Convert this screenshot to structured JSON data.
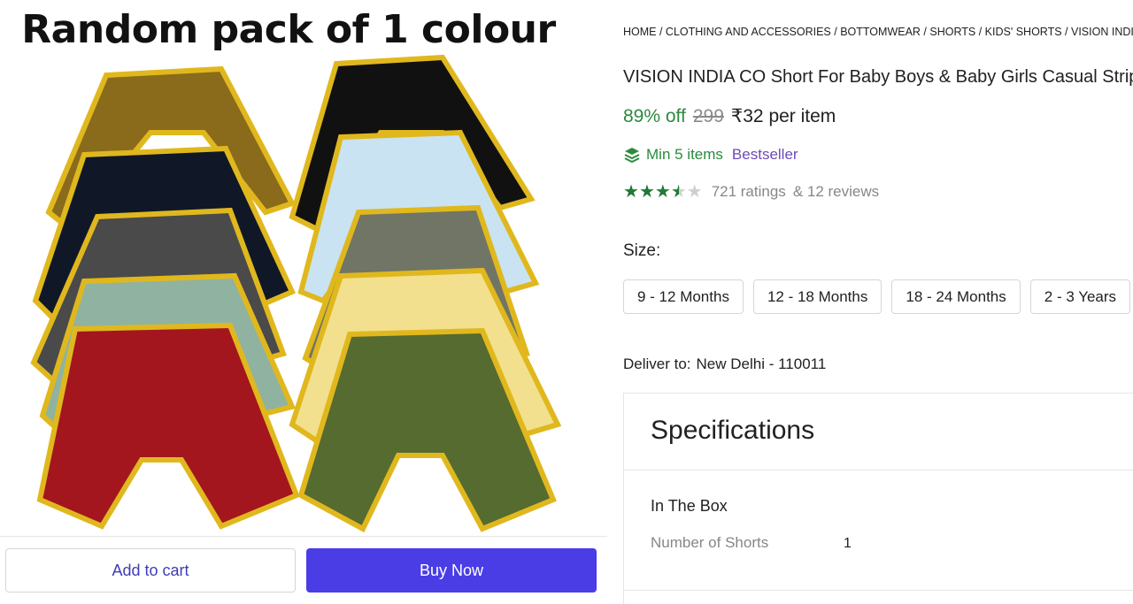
{
  "product_image": {
    "caption": "Random pack of 1 colour",
    "icon": "shorts-product-image"
  },
  "actions": {
    "add_to_cart": "Add to cart",
    "buy_now": "Buy Now"
  },
  "breadcrumbs": [
    "HOME",
    "CLOTHING AND ACCESSORIES",
    "BOTTOMWEAR",
    "SHORTS",
    "KIDS' SHORTS",
    "VISION INDIA CO"
  ],
  "product": {
    "title": "VISION INDIA CO Short For Baby Boys & Baby Girls Casual Striped",
    "discount": "89% off",
    "mrp": "299",
    "price": "₹32 per item",
    "min_items": "Min 5 items",
    "badge": "Bestseller",
    "rating_value": 3.5,
    "ratings_text": "721 ratings",
    "reviews_text": "& 12 reviews"
  },
  "size": {
    "label": "Size:",
    "options": [
      "9 - 12 Months",
      "12 - 18 Months",
      "18 - 24 Months",
      "2 - 3 Years"
    ]
  },
  "delivery": {
    "label": "Deliver to:",
    "location": "New Delhi - 110011"
  },
  "specifications": {
    "title": "Specifications",
    "section": "In The Box",
    "rows": [
      {
        "key": "Number of Shorts",
        "value": "1"
      }
    ]
  },
  "colors": {
    "accent": "#4a3de6",
    "discount_green": "#2b8a3e",
    "badge_purple": "#6e4ab8",
    "star_green": "#1f7a34"
  }
}
